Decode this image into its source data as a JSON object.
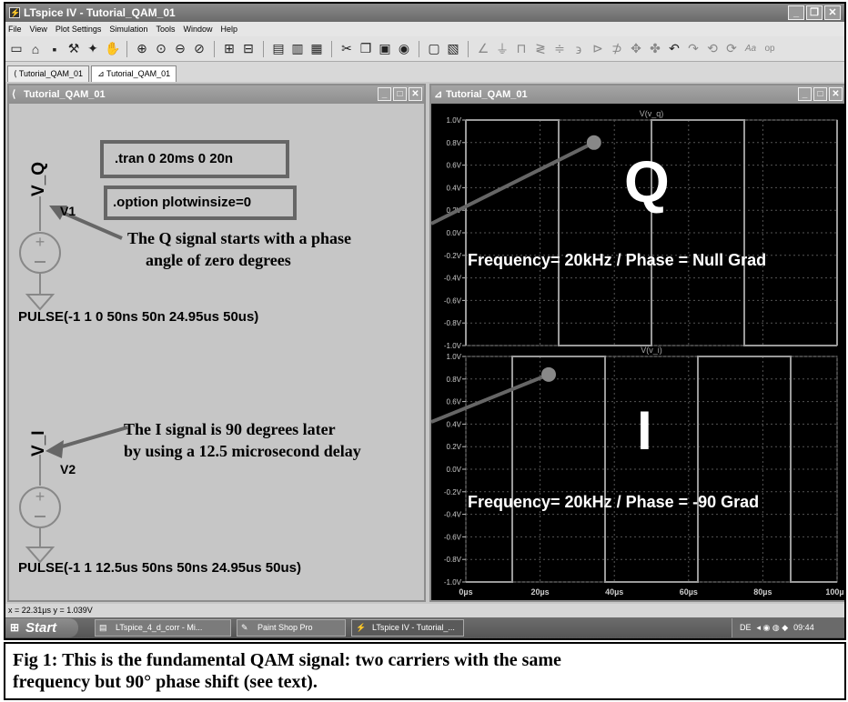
{
  "window": {
    "title": "LTspice IV - Tutorial_QAM_01"
  },
  "menu": [
    "File",
    "View",
    "Plot Settings",
    "Simulation",
    "Tools",
    "Window",
    "Help"
  ],
  "tabs": [
    {
      "label": "Tutorial_QAM_01",
      "icon": "schematic-icon"
    },
    {
      "label": "Tutorial_QAM_01",
      "icon": "waveform-icon"
    }
  ],
  "schematic": {
    "title": "Tutorial_QAM_01",
    "directive1": ".tran 0 20ms 0 20n",
    "directive2": ".option plotwinsize=0",
    "net_q": "V_Q",
    "net_i": "V_I",
    "v1": "V1",
    "v2": "V2",
    "pulse1": "PULSE(-1 1 0 50ns 50n 24.95us 50us)",
    "pulse2": "PULSE(-1 1 12.5us 50ns 50ns 24.95us 50us)",
    "annot_q_1": "The Q signal starts with a phase",
    "annot_q_2": "angle of zero degrees",
    "annot_i_1": "The I signal is 90 degrees later",
    "annot_i_2": "by using a 12.5 microsecond delay"
  },
  "plot": {
    "title": "Tutorial_QAM_01",
    "top_trace": "V(v_q)",
    "bottom_trace": "V(v_i)",
    "top_big_letter": "Q",
    "bottom_big_letter": "I",
    "top_note": "Frequency= 20kHz / Phase = Null Grad",
    "bottom_note": "Frequency= 20kHz / Phase = -90 Grad"
  },
  "chart_data": [
    {
      "type": "line",
      "title": "V(v_q)",
      "xlabel": "",
      "ylabel": "",
      "xlim": [
        0,
        100
      ],
      "ylim": [
        -1.0,
        1.0
      ],
      "yticks": [
        "1.0V",
        "0.8V",
        "0.6V",
        "0.4V",
        "0.2V",
        "0.0V",
        "-0.2V",
        "-0.4V",
        "-0.6V",
        "-0.8V",
        "-1.0V"
      ],
      "xticks": [
        "0µs",
        "20µs",
        "40µs",
        "60µs",
        "80µs",
        "100µs"
      ],
      "series": [
        {
          "name": "V(v_q)",
          "edges_us": [
            0,
            25,
            50,
            75,
            100
          ]
        }
      ]
    },
    {
      "type": "line",
      "title": "V(v_i)",
      "xlabel": "",
      "ylabel": "",
      "xlim": [
        0,
        100
      ],
      "ylim": [
        -1.0,
        1.0
      ],
      "yticks": [
        "1.0V",
        "0.8V",
        "0.6V",
        "0.4V",
        "0.2V",
        "0.0V",
        "-0.2V",
        "-0.4V",
        "-0.6V",
        "-0.8V",
        "-1.0V"
      ],
      "xticks": [
        "0µs",
        "20µs",
        "40µs",
        "60µs",
        "80µs",
        "100µs"
      ],
      "series": [
        {
          "name": "V(v_i)",
          "edges_us": [
            12.5,
            37.5,
            62.5,
            87.5
          ]
        }
      ]
    }
  ],
  "status": {
    "coords": "x = 22.31µs   y = 1.039V"
  },
  "taskbar": {
    "start": "Start",
    "tasks": [
      "LTspice_4_d_corr - Mi...",
      "Paint Shop Pro",
      "LTspice IV - Tutorial_..."
    ],
    "lang": "DE",
    "clock": "09:44"
  },
  "caption": {
    "line1": "Fig 1:  This is the fundamental QAM signal: two carriers with the same",
    "line2": "frequency but 90° phase shift (see text)."
  }
}
